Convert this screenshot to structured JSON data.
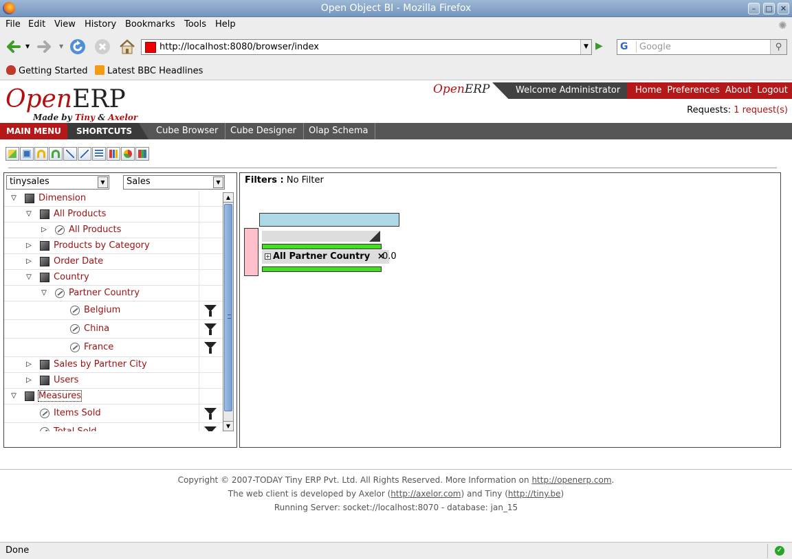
{
  "window": {
    "title": "Open Object BI - Mozilla Firefox"
  },
  "menubar": {
    "items": [
      "File",
      "Edit",
      "View",
      "History",
      "Bookmarks",
      "Tools",
      "Help"
    ]
  },
  "navbar": {
    "url": "http://localhost:8080/browser/index",
    "search_placeholder": "Google"
  },
  "bookmarks": {
    "items": [
      "Getting Started",
      "Latest BBC Headlines"
    ]
  },
  "erp": {
    "logo_open": "Open",
    "logo_erp": "ERP",
    "logo_made_by": "Made by",
    "logo_tiny": "Tiny",
    "logo_amp": "&",
    "logo_axelor": "Axelor",
    "welcome": "Welcome Administrator",
    "links": [
      "Home",
      "Preferences",
      "About",
      "Logout"
    ],
    "requests_label": "Requests:",
    "requests_link": "1 request(s)"
  },
  "mainbar": {
    "main_menu": "MAIN MENU",
    "shortcuts": "SHORTCUTS",
    "tabs": [
      "Cube Browser",
      "Cube Designer",
      "Olap Schema"
    ]
  },
  "left": {
    "schema_select": "tinysales",
    "cube_select": "Sales",
    "tree": [
      {
        "label": "Dimension",
        "level": 0,
        "expand": "open",
        "icon": "cube-icon",
        "filter": false
      },
      {
        "label": "All Products",
        "level": 1,
        "expand": "open",
        "icon": "cube-icon",
        "filter": false
      },
      {
        "label": "All Products",
        "level": 2,
        "expand": "closed",
        "icon": "link-icon",
        "filter": false
      },
      {
        "label": "Products by Category",
        "level": 1,
        "expand": "closed",
        "icon": "cube-icon",
        "filter": false
      },
      {
        "label": "Order Date",
        "level": 1,
        "expand": "closed",
        "icon": "cube-icon",
        "filter": false
      },
      {
        "label": "Country",
        "level": 1,
        "expand": "open",
        "icon": "cube-icon",
        "filter": false
      },
      {
        "label": "Partner Country",
        "level": 2,
        "expand": "open",
        "icon": "link-icon",
        "filter": false
      },
      {
        "label": "Belgium",
        "level": 3,
        "expand": "none",
        "icon": "link-icon",
        "filter": true
      },
      {
        "label": "China",
        "level": 3,
        "expand": "none",
        "icon": "link-icon",
        "filter": true
      },
      {
        "label": "France",
        "level": 3,
        "expand": "none",
        "icon": "link-icon",
        "filter": true
      },
      {
        "label": "Sales by Partner City",
        "level": 1,
        "expand": "closed",
        "icon": "cube-icon",
        "filter": false
      },
      {
        "label": "Users",
        "level": 1,
        "expand": "closed",
        "icon": "cube-icon",
        "filter": false
      },
      {
        "label": "Measures",
        "level": 0,
        "expand": "open",
        "icon": "cube-icon",
        "filter": false
      },
      {
        "label": "Items Sold",
        "level": 1,
        "expand": "none",
        "icon": "link-icon",
        "filter": true
      },
      {
        "label": "Total Sold",
        "level": 1,
        "expand": "none",
        "icon": "link-icon",
        "filter": true
      }
    ]
  },
  "right": {
    "filters_label": "Filters :",
    "filters_value": "No Filter",
    "row_header": "All Partner Country",
    "cell_value": "0.0"
  },
  "footer": {
    "line1_text": "Copyright © 2007-TODAY Tiny ERP Pvt. Ltd. All Rights Reserved. More Information on",
    "line1_link": "http://openerp.com",
    "line1_end": ".",
    "line2_a": "The web client is developed by Axelor (",
    "line2_link1": "http://axelor.com",
    "line2_b": ") and Tiny (",
    "line2_link2": "http://tiny.be",
    "line2_c": ")",
    "line3": "Running Server: socket://localhost:8070 - database: jan_15"
  },
  "status": {
    "text": "Done"
  }
}
